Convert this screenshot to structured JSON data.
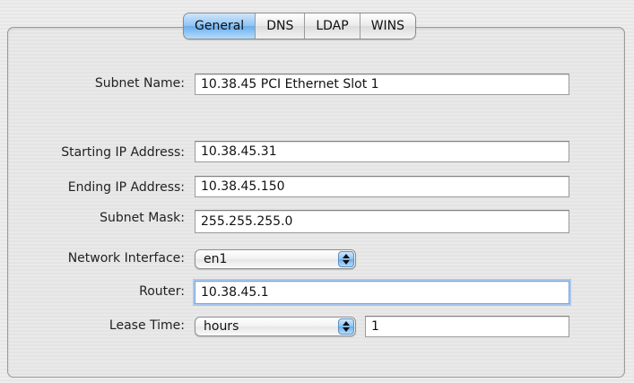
{
  "tabs": [
    {
      "label": "General",
      "active": true
    },
    {
      "label": "DNS",
      "active": false
    },
    {
      "label": "LDAP",
      "active": false
    },
    {
      "label": "WINS",
      "active": false
    }
  ],
  "form": {
    "subnet_name": {
      "label": "Subnet Name:",
      "value": "10.38.45 PCI Ethernet Slot 1"
    },
    "starting_ip": {
      "label": "Starting IP Address:",
      "value": "10.38.45.31"
    },
    "ending_ip": {
      "label": "Ending IP Address:",
      "value": "10.38.45.150"
    },
    "subnet_mask": {
      "label": "Subnet Mask:",
      "value": "255.255.255.0"
    },
    "network_interface": {
      "label": "Network Interface:",
      "selected": "en1"
    },
    "router": {
      "label": "Router:",
      "value": "10.38.45.1"
    },
    "lease_time": {
      "label": "Lease Time:",
      "unit_selected": "hours",
      "value": "1"
    }
  },
  "colors": {
    "accent": "#6aaeee",
    "focus_ring": "#a9c8ef"
  }
}
